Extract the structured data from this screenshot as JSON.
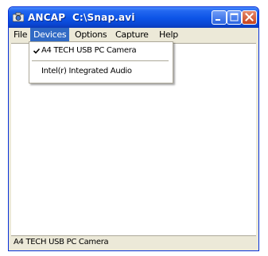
{
  "window": {
    "title": "ANCAP  C:\\Snap.avi",
    "buttons": {
      "minimize_icon": "minimize-icon",
      "maximize_icon": "maximize-icon",
      "close_icon": "close-icon"
    }
  },
  "menubar": {
    "items": [
      {
        "label": "File"
      },
      {
        "label": "Devices",
        "active": true
      },
      {
        "label": "Options"
      },
      {
        "label": "Capture"
      },
      {
        "label": "Help"
      }
    ]
  },
  "devices_menu": {
    "items": [
      {
        "label": "A4 TECH USB PC Camera",
        "checked": true
      },
      {
        "label": "Intel(r) Integrated Audio",
        "checked": false
      }
    ]
  },
  "statusbar": {
    "text": "A4 TECH USB PC Camera"
  },
  "colors": {
    "titlebar": "#0c53e6",
    "menu_highlight": "#316ac5",
    "close_button": "#c8431c"
  }
}
